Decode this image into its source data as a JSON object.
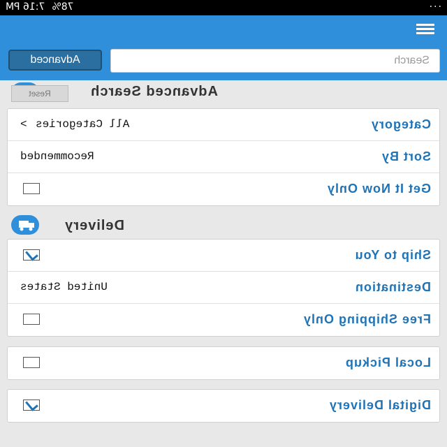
{
  "status_bar": {
    "time": "7:16 PM",
    "battery": "78%"
  },
  "search": {
    "placeholder": "Search",
    "advanced_label": "Advanced"
  },
  "advanced_search": {
    "title": "Advanced Search",
    "reset_label": "Reset",
    "rows": [
      {
        "label": "Category",
        "value": "All Categories"
      },
      {
        "label": "Sort By",
        "value": "Recommended"
      },
      {
        "label": "Get It Now Only",
        "checked": false
      }
    ]
  },
  "delivery": {
    "title": "Delivery",
    "rows": [
      {
        "label": "Ship to You",
        "checked": true
      },
      {
        "label": "Destination",
        "value": "United States"
      },
      {
        "label": "Free Shipping Only",
        "checked": false
      }
    ]
  },
  "local_pickup": {
    "label": "Local Pickup",
    "checked": false
  },
  "digital_delivery": {
    "label": "Digital Delivery",
    "checked": true
  },
  "colors": {
    "appbar": "#2f8fdb",
    "label": "#1f73b7"
  }
}
